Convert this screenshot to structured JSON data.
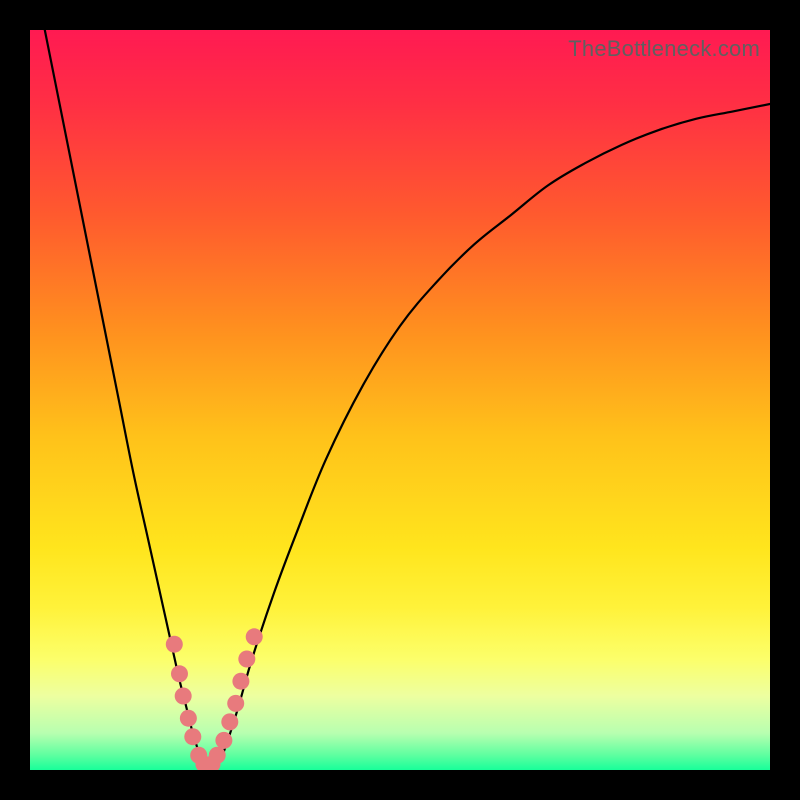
{
  "watermark": "TheBottleneck.com",
  "colors": {
    "frame": "#000000",
    "gradient_stops": [
      {
        "offset": 0.0,
        "color": "#ff1a52"
      },
      {
        "offset": 0.1,
        "color": "#ff2f44"
      },
      {
        "offset": 0.25,
        "color": "#ff5a2e"
      },
      {
        "offset": 0.4,
        "color": "#ff8e1f"
      },
      {
        "offset": 0.55,
        "color": "#ffc21a"
      },
      {
        "offset": 0.7,
        "color": "#ffe51d"
      },
      {
        "offset": 0.78,
        "color": "#fff23a"
      },
      {
        "offset": 0.85,
        "color": "#fcff6a"
      },
      {
        "offset": 0.9,
        "color": "#edffa0"
      },
      {
        "offset": 0.95,
        "color": "#b8ffb0"
      },
      {
        "offset": 0.98,
        "color": "#5effa0"
      },
      {
        "offset": 1.0,
        "color": "#18ff9a"
      }
    ],
    "curve": "#000000",
    "marker_fill": "#e87a7d",
    "marker_stroke": "#c45a5c"
  },
  "chart_data": {
    "type": "line",
    "title": "",
    "xlabel": "",
    "ylabel": "",
    "xlim": [
      0,
      100
    ],
    "ylim": [
      0,
      100
    ],
    "grid": false,
    "series": [
      {
        "name": "bottleneck-curve",
        "x": [
          2,
          4,
          6,
          8,
          10,
          12,
          14,
          16,
          18,
          20,
          21,
          22,
          23,
          24,
          25,
          26,
          28,
          30,
          33,
          36,
          40,
          45,
          50,
          55,
          60,
          65,
          70,
          75,
          80,
          85,
          90,
          95,
          100
        ],
        "y": [
          100,
          90,
          80,
          70,
          60,
          50,
          40,
          31,
          22,
          13,
          9,
          5,
          2,
          0.5,
          0.5,
          2,
          8,
          15,
          24,
          32,
          42,
          52,
          60,
          66,
          71,
          75,
          79,
          82,
          84.5,
          86.5,
          88,
          89,
          90
        ]
      }
    ],
    "markers": [
      {
        "x": 19.5,
        "y": 17
      },
      {
        "x": 20.2,
        "y": 13
      },
      {
        "x": 20.7,
        "y": 10
      },
      {
        "x": 21.4,
        "y": 7
      },
      {
        "x": 22.0,
        "y": 4.5
      },
      {
        "x": 22.8,
        "y": 2
      },
      {
        "x": 23.5,
        "y": 0.8
      },
      {
        "x": 24.0,
        "y": 0.5
      },
      {
        "x": 24.6,
        "y": 0.8
      },
      {
        "x": 25.3,
        "y": 2
      },
      {
        "x": 26.2,
        "y": 4
      },
      {
        "x": 27.0,
        "y": 6.5
      },
      {
        "x": 27.8,
        "y": 9
      },
      {
        "x": 28.5,
        "y": 12
      },
      {
        "x": 29.3,
        "y": 15
      },
      {
        "x": 30.3,
        "y": 18
      }
    ]
  }
}
